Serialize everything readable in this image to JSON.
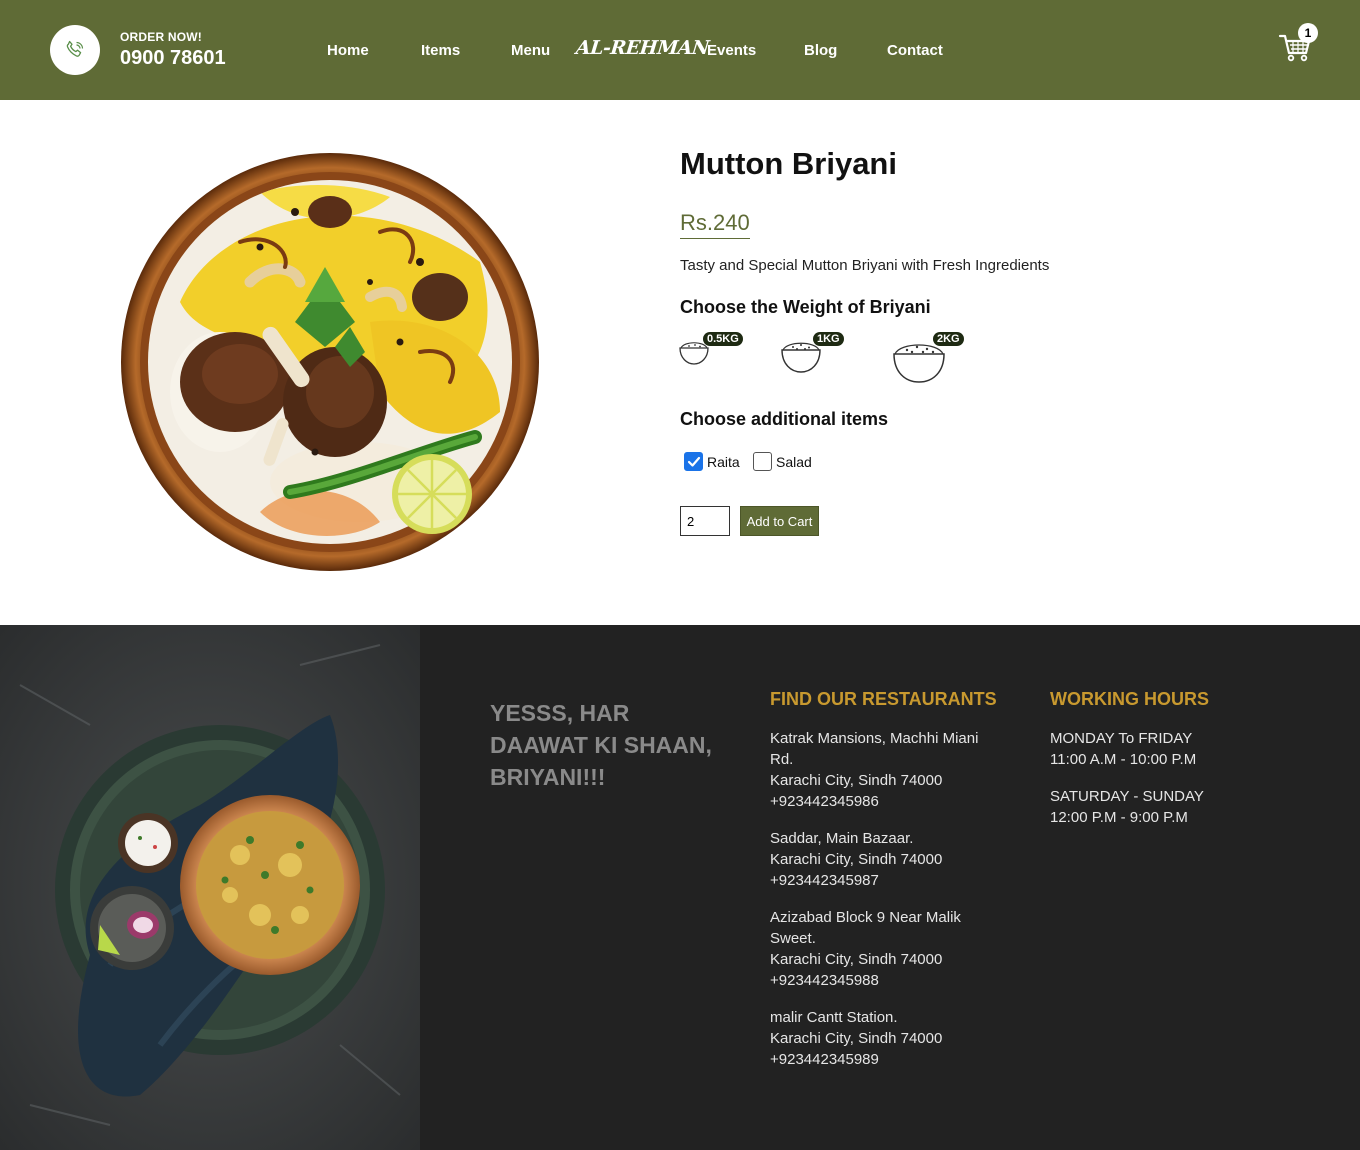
{
  "header": {
    "order_label": "ORDER NOW!",
    "phone": "0900 78601",
    "nav": [
      "Home",
      "Items",
      "Menu",
      "Events",
      "Blog",
      "Contact"
    ],
    "brand": "AL-REHMAN",
    "cart_count": "1",
    "icons": {
      "phone": "phone-icon",
      "cart": "cart-icon"
    }
  },
  "product": {
    "title": "Mutton Briyani",
    "price": "Rs.240",
    "description": "Tasty and Special Mutton Briyani with Fresh Ingredients",
    "weight_heading": "Choose the Weight of Briyani",
    "weights": [
      "0.5KG",
      "1KG",
      "2KG"
    ],
    "addons_heading": "Choose additional items",
    "addons": [
      {
        "label": "Raita",
        "checked": true
      },
      {
        "label": "Salad",
        "checked": false
      }
    ],
    "quantity": "2",
    "add_to_cart": "Add to Cart"
  },
  "footer": {
    "tagline": [
      "YESSS, HAR",
      "DAAWAT KI SHAAN,",
      "BRIYANI!!!"
    ],
    "restaurants_heading": "FIND OUR RESTAURANTS",
    "restaurants": [
      {
        "lines": [
          "Katrak Mansions, Machhi Miani",
          "Rd.",
          "Karachi City, Sindh 74000",
          "+923442345986"
        ]
      },
      {
        "lines": [
          "Saddar, Main Bazaar.",
          "Karachi City, Sindh 74000",
          "+923442345987"
        ]
      },
      {
        "lines": [
          "Azizabad Block 9 Near Malik",
          "Sweet.",
          "Karachi City, Sindh 74000",
          "+923442345988"
        ]
      },
      {
        "lines": [
          "malir Cantt Station.",
          "Karachi City, Sindh 74000",
          "+923442345989"
        ]
      }
    ],
    "hours_heading": "WORKING HOURS",
    "hours": [
      {
        "days": "MONDAY To FRIDAY",
        "time": "11:00 A.M - 10:00 P.M"
      },
      {
        "days": "SATURDAY - SUNDAY",
        "time": "12:00 P.M - 9:00 P.M"
      }
    ]
  },
  "colors": {
    "brand_green": "#5f6b36",
    "footer_bg": "#222222",
    "accent_gold": "#c8992f",
    "checkbox_blue": "#1a73e8"
  }
}
